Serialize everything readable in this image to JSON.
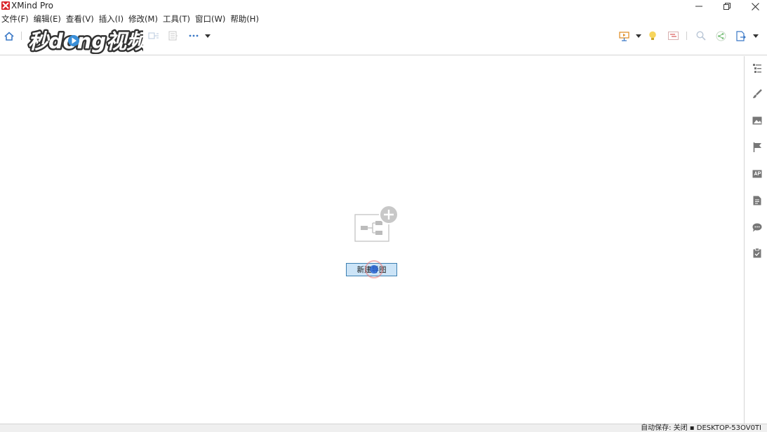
{
  "window": {
    "title": "XMind Pro",
    "icon": "xmind-logo-icon",
    "controls": [
      "minimize-icon",
      "restore-icon",
      "close-icon"
    ]
  },
  "menu": [
    {
      "label": "文件(F)"
    },
    {
      "label": "编辑(E)"
    },
    {
      "label": "查看(V)"
    },
    {
      "label": "插入(I)"
    },
    {
      "label": "修改(M)"
    },
    {
      "label": "工具(T)"
    },
    {
      "label": "窗口(W)"
    },
    {
      "label": "帮助(H)"
    }
  ],
  "toolbar": {
    "left_icons": [
      "home-icon",
      "topic-icon",
      "subtopic-icon",
      "more-icon",
      "dropdown-arrow-icon"
    ],
    "right_icons": [
      "presentation-icon",
      "dropdown-arrow-icon",
      "brainstorm-lightbulb-icon",
      "gantt-icon",
      "search-icon",
      "share-icon",
      "export-icon",
      "dropdown-arrow-icon"
    ]
  },
  "watermark": {
    "text": "秒dong视频"
  },
  "canvas": {
    "new_map_button_label": "新建导图"
  },
  "sidebar": {
    "icons": [
      "outliner-icon",
      "format-brush-icon",
      "image-icon",
      "marker-flag-icon",
      "icon-library-icon",
      "notes-icon",
      "comment-icon",
      "task-icon"
    ]
  },
  "status": {
    "text": "自动保存: 关闭 ▪ DESKTOP-53OV0TI"
  },
  "colors": {
    "accent": "#3c7fb1",
    "button_bg": "#cce4f7",
    "app_red": "#d9252a"
  }
}
